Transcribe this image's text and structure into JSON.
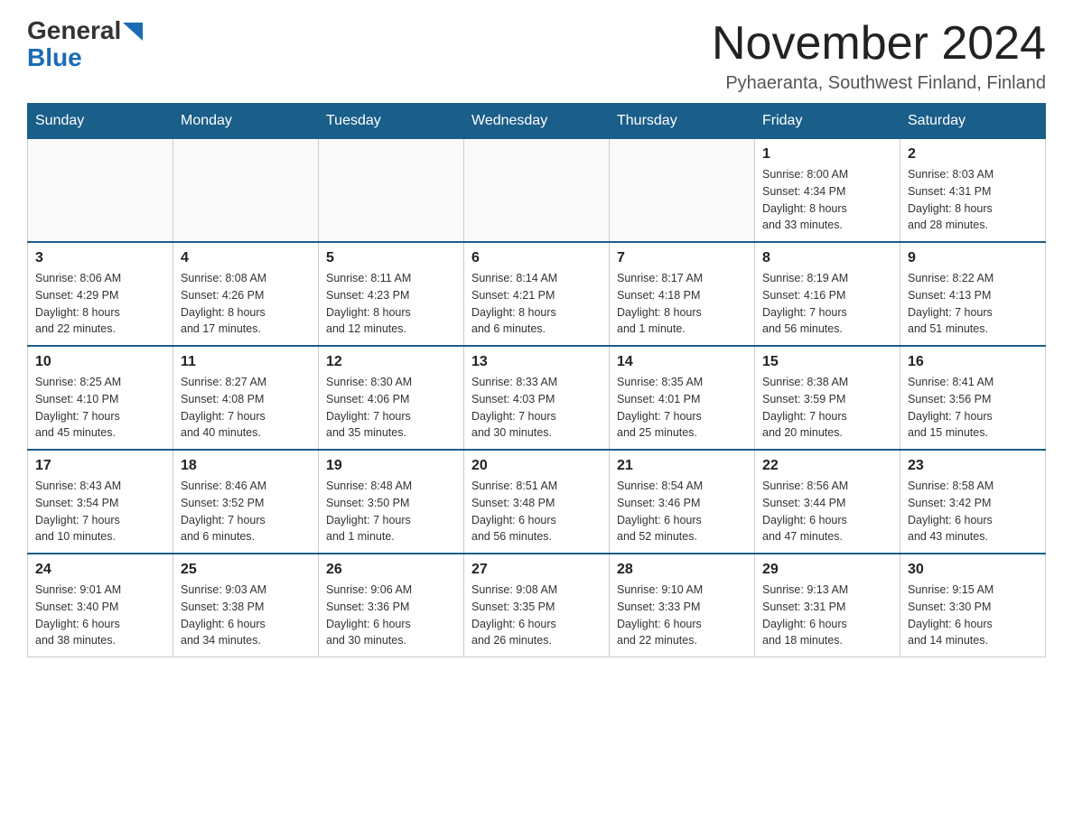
{
  "header": {
    "logo_general": "General",
    "logo_blue": "Blue",
    "month_title": "November 2024",
    "location": "Pyhaeranta, Southwest Finland, Finland"
  },
  "days_of_week": [
    "Sunday",
    "Monday",
    "Tuesday",
    "Wednesday",
    "Thursday",
    "Friday",
    "Saturday"
  ],
  "weeks": [
    {
      "days": [
        {
          "number": "",
          "info": ""
        },
        {
          "number": "",
          "info": ""
        },
        {
          "number": "",
          "info": ""
        },
        {
          "number": "",
          "info": ""
        },
        {
          "number": "",
          "info": ""
        },
        {
          "number": "1",
          "info": "Sunrise: 8:00 AM\nSunset: 4:34 PM\nDaylight: 8 hours\nand 33 minutes."
        },
        {
          "number": "2",
          "info": "Sunrise: 8:03 AM\nSunset: 4:31 PM\nDaylight: 8 hours\nand 28 minutes."
        }
      ]
    },
    {
      "days": [
        {
          "number": "3",
          "info": "Sunrise: 8:06 AM\nSunset: 4:29 PM\nDaylight: 8 hours\nand 22 minutes."
        },
        {
          "number": "4",
          "info": "Sunrise: 8:08 AM\nSunset: 4:26 PM\nDaylight: 8 hours\nand 17 minutes."
        },
        {
          "number": "5",
          "info": "Sunrise: 8:11 AM\nSunset: 4:23 PM\nDaylight: 8 hours\nand 12 minutes."
        },
        {
          "number": "6",
          "info": "Sunrise: 8:14 AM\nSunset: 4:21 PM\nDaylight: 8 hours\nand 6 minutes."
        },
        {
          "number": "7",
          "info": "Sunrise: 8:17 AM\nSunset: 4:18 PM\nDaylight: 8 hours\nand 1 minute."
        },
        {
          "number": "8",
          "info": "Sunrise: 8:19 AM\nSunset: 4:16 PM\nDaylight: 7 hours\nand 56 minutes."
        },
        {
          "number": "9",
          "info": "Sunrise: 8:22 AM\nSunset: 4:13 PM\nDaylight: 7 hours\nand 51 minutes."
        }
      ]
    },
    {
      "days": [
        {
          "number": "10",
          "info": "Sunrise: 8:25 AM\nSunset: 4:10 PM\nDaylight: 7 hours\nand 45 minutes."
        },
        {
          "number": "11",
          "info": "Sunrise: 8:27 AM\nSunset: 4:08 PM\nDaylight: 7 hours\nand 40 minutes."
        },
        {
          "number": "12",
          "info": "Sunrise: 8:30 AM\nSunset: 4:06 PM\nDaylight: 7 hours\nand 35 minutes."
        },
        {
          "number": "13",
          "info": "Sunrise: 8:33 AM\nSunset: 4:03 PM\nDaylight: 7 hours\nand 30 minutes."
        },
        {
          "number": "14",
          "info": "Sunrise: 8:35 AM\nSunset: 4:01 PM\nDaylight: 7 hours\nand 25 minutes."
        },
        {
          "number": "15",
          "info": "Sunrise: 8:38 AM\nSunset: 3:59 PM\nDaylight: 7 hours\nand 20 minutes."
        },
        {
          "number": "16",
          "info": "Sunrise: 8:41 AM\nSunset: 3:56 PM\nDaylight: 7 hours\nand 15 minutes."
        }
      ]
    },
    {
      "days": [
        {
          "number": "17",
          "info": "Sunrise: 8:43 AM\nSunset: 3:54 PM\nDaylight: 7 hours\nand 10 minutes."
        },
        {
          "number": "18",
          "info": "Sunrise: 8:46 AM\nSunset: 3:52 PM\nDaylight: 7 hours\nand 6 minutes."
        },
        {
          "number": "19",
          "info": "Sunrise: 8:48 AM\nSunset: 3:50 PM\nDaylight: 7 hours\nand 1 minute."
        },
        {
          "number": "20",
          "info": "Sunrise: 8:51 AM\nSunset: 3:48 PM\nDaylight: 6 hours\nand 56 minutes."
        },
        {
          "number": "21",
          "info": "Sunrise: 8:54 AM\nSunset: 3:46 PM\nDaylight: 6 hours\nand 52 minutes."
        },
        {
          "number": "22",
          "info": "Sunrise: 8:56 AM\nSunset: 3:44 PM\nDaylight: 6 hours\nand 47 minutes."
        },
        {
          "number": "23",
          "info": "Sunrise: 8:58 AM\nSunset: 3:42 PM\nDaylight: 6 hours\nand 43 minutes."
        }
      ]
    },
    {
      "days": [
        {
          "number": "24",
          "info": "Sunrise: 9:01 AM\nSunset: 3:40 PM\nDaylight: 6 hours\nand 38 minutes."
        },
        {
          "number": "25",
          "info": "Sunrise: 9:03 AM\nSunset: 3:38 PM\nDaylight: 6 hours\nand 34 minutes."
        },
        {
          "number": "26",
          "info": "Sunrise: 9:06 AM\nSunset: 3:36 PM\nDaylight: 6 hours\nand 30 minutes."
        },
        {
          "number": "27",
          "info": "Sunrise: 9:08 AM\nSunset: 3:35 PM\nDaylight: 6 hours\nand 26 minutes."
        },
        {
          "number": "28",
          "info": "Sunrise: 9:10 AM\nSunset: 3:33 PM\nDaylight: 6 hours\nand 22 minutes."
        },
        {
          "number": "29",
          "info": "Sunrise: 9:13 AM\nSunset: 3:31 PM\nDaylight: 6 hours\nand 18 minutes."
        },
        {
          "number": "30",
          "info": "Sunrise: 9:15 AM\nSunset: 3:30 PM\nDaylight: 6 hours\nand 14 minutes."
        }
      ]
    }
  ]
}
